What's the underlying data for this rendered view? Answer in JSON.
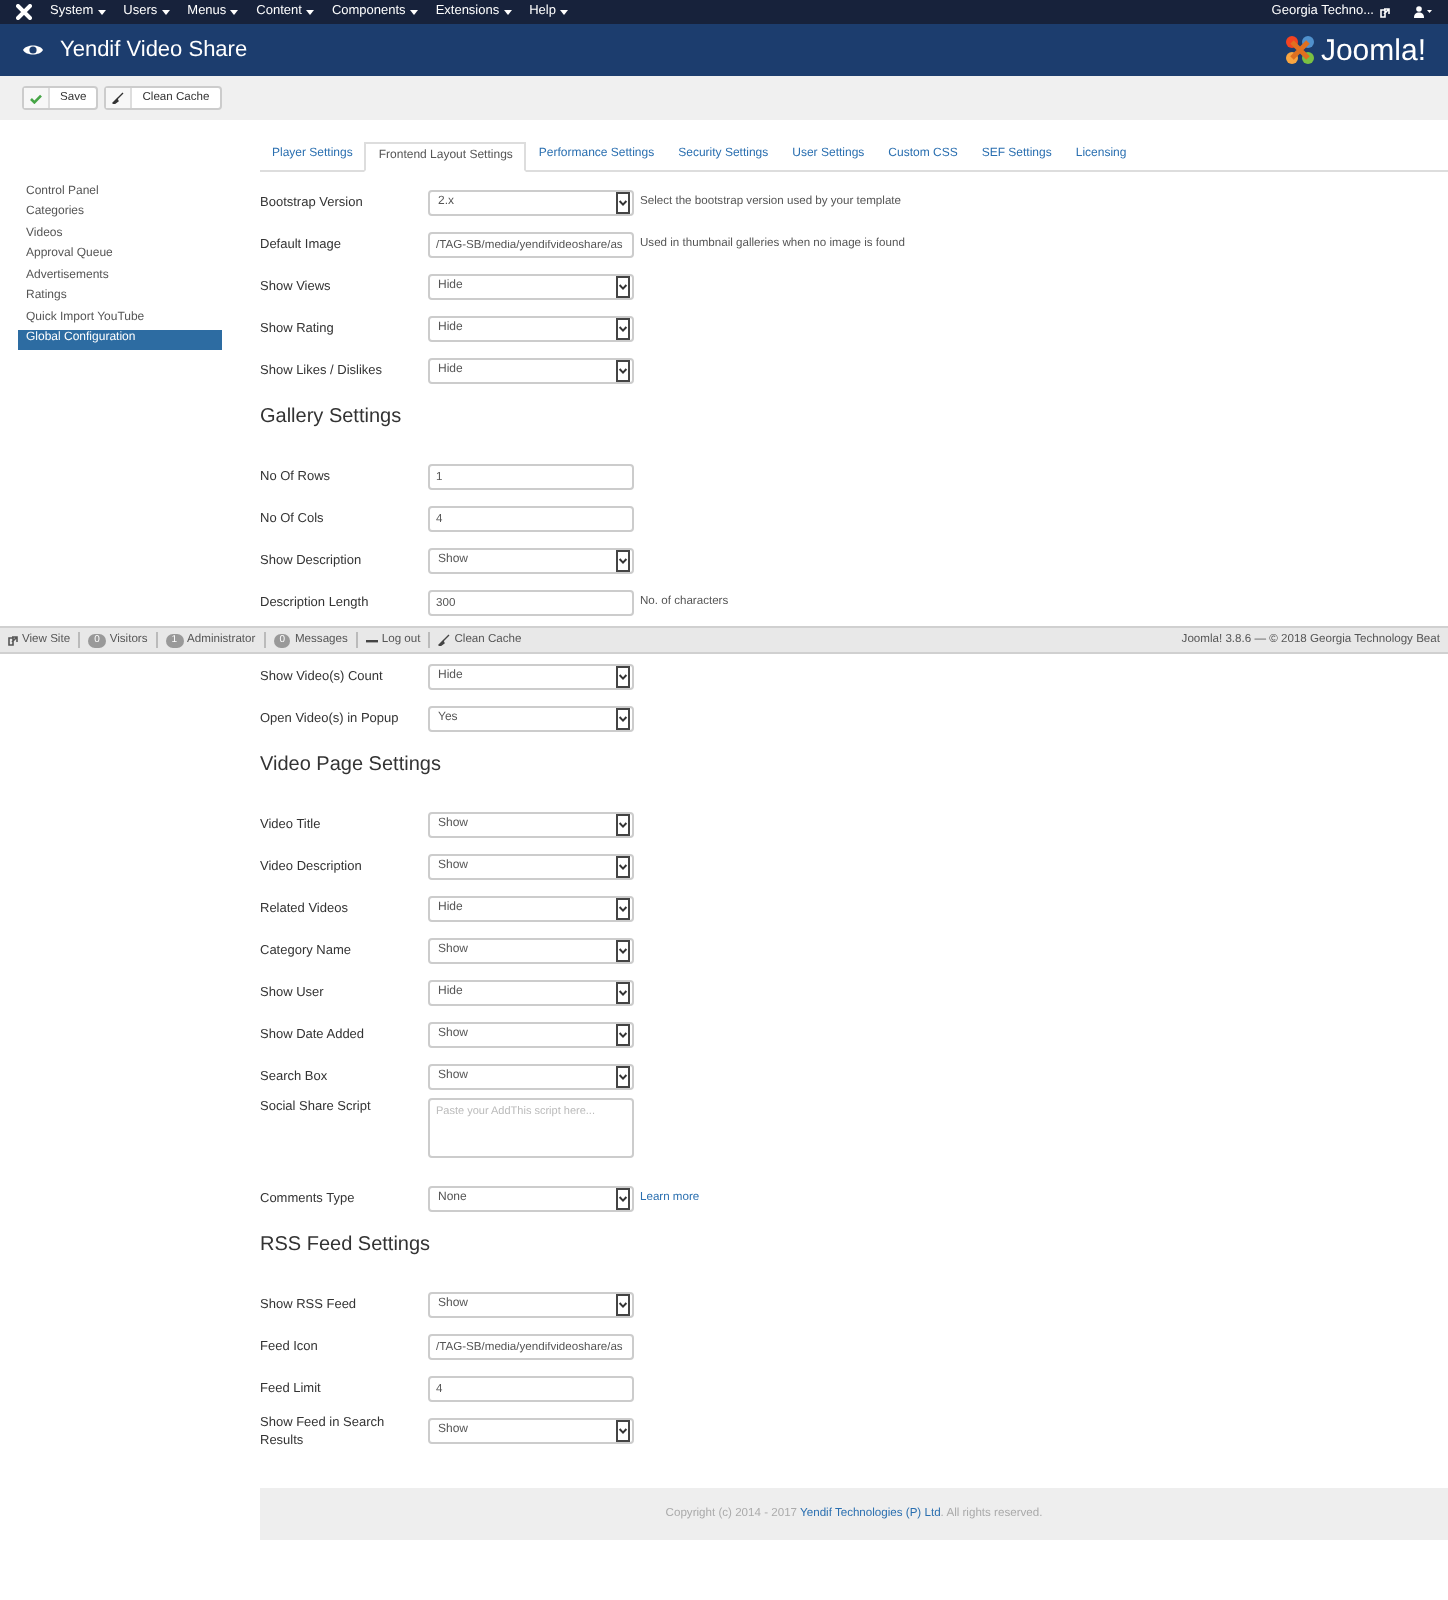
{
  "topbar": {
    "menus": [
      "System",
      "Users",
      "Menus",
      "Content",
      "Components",
      "Extensions",
      "Help"
    ],
    "site": "Georgia Techno..."
  },
  "header": {
    "title": "Yendif Video Share",
    "logo_text": "Joomla!"
  },
  "toolbar": {
    "buttons": [
      {
        "label": "Save",
        "kind": "save"
      },
      {
        "label": "Clean Cache",
        "kind": "clean"
      }
    ]
  },
  "sidebar": {
    "items": [
      {
        "label": "Control Panel",
        "selected": false
      },
      {
        "label": "Categories",
        "selected": false
      },
      {
        "label": "Videos",
        "selected": false
      },
      {
        "label": "Approval Queue",
        "selected": false
      },
      {
        "label": "Advertisements",
        "selected": false
      },
      {
        "label": "Ratings",
        "selected": false
      },
      {
        "label": "Quick Import YouTube",
        "selected": false
      },
      {
        "label": "Global Configuration",
        "selected": true
      }
    ]
  },
  "tabs": [
    {
      "label": "Player Settings",
      "selected": false
    },
    {
      "label": "Frontend Layout Settings",
      "selected": true
    },
    {
      "label": "Performance Settings",
      "selected": false
    },
    {
      "label": "Security Settings",
      "selected": false
    },
    {
      "label": "User Settings",
      "selected": false
    },
    {
      "label": "Custom CSS",
      "selected": false
    },
    {
      "label": "SEF Settings",
      "selected": false
    },
    {
      "label": "Licensing",
      "selected": false
    }
  ],
  "sections": [
    {
      "fields": [
        {
          "label": "Bootstrap Version",
          "kind": "select",
          "value": "2.x",
          "help": "Select the bootstrap version used by your template"
        },
        {
          "label": "Default Image",
          "kind": "text",
          "value": "/TAG-SB/media/yendifvideoshare/as",
          "help": "Used in thumbnail galleries when no image is found"
        },
        {
          "label": "Show Views",
          "kind": "select",
          "value": "Hide"
        },
        {
          "label": "Show Rating",
          "kind": "select",
          "value": "Hide"
        },
        {
          "label": "Show Likes / Dislikes",
          "kind": "select",
          "value": "Hide"
        }
      ]
    },
    {
      "heading": "Gallery Settings",
      "fields": [
        {
          "label": "No Of Rows",
          "kind": "text",
          "value": "1"
        },
        {
          "label": "No Of Cols",
          "kind": "text",
          "value": "4"
        },
        {
          "label": "Show Description",
          "kind": "select",
          "value": "Show"
        },
        {
          "label": "Description Length",
          "kind": "text",
          "value": "300",
          "help": "No. of characters"
        },
        {
          "kind": "statusbar"
        },
        {
          "label": "Show Video(s) Count",
          "kind": "select",
          "value": "Hide"
        },
        {
          "label": "Open Video(s) in Popup",
          "kind": "select",
          "value": "Yes"
        }
      ]
    },
    {
      "heading": "Video Page Settings",
      "fields": [
        {
          "label": "Video Title",
          "kind": "select",
          "value": "Show"
        },
        {
          "label": "Video Description",
          "kind": "select",
          "value": "Show"
        },
        {
          "label": "Related Videos",
          "kind": "select",
          "value": "Hide"
        },
        {
          "label": "Category Name",
          "kind": "select",
          "value": "Show"
        },
        {
          "label": "Show User",
          "kind": "select",
          "value": "Hide"
        },
        {
          "label": "Show Date Added",
          "kind": "select",
          "value": "Show"
        },
        {
          "label": "Search Box",
          "kind": "select",
          "value": "Show"
        },
        {
          "label": "Social Share Script",
          "kind": "textarea",
          "placeholder": "Paste your AddThis script here..."
        },
        {
          "label": "Comments Type",
          "kind": "select",
          "value": "None",
          "link": "Learn more"
        }
      ]
    },
    {
      "heading": "RSS Feed Settings",
      "fields": [
        {
          "label": "Show RSS Feed",
          "kind": "select",
          "value": "Show"
        },
        {
          "label": "Feed Icon",
          "kind": "text",
          "value": "/TAG-SB/media/yendifvideoshare/as"
        },
        {
          "label": "Feed Limit",
          "kind": "text",
          "value": "4"
        },
        {
          "label": "Show Feed in Search Results",
          "kind": "select",
          "value": "Show"
        }
      ]
    }
  ],
  "status_bar": {
    "items": [
      {
        "kind": "link",
        "label": "View Site"
      },
      {
        "kind": "count",
        "count": "0",
        "label": "Visitors"
      },
      {
        "kind": "count",
        "count": "1",
        "label": "Administrator"
      },
      {
        "kind": "count",
        "count": "0",
        "label": "Messages"
      },
      {
        "kind": "logout",
        "label": "Log out"
      },
      {
        "kind": "clean",
        "label": "Clean Cache"
      }
    ],
    "version": "Joomla! 3.8.6 — © 2018 Georgia Technology Beat"
  },
  "footer": {
    "before": "Copyright (c) 2014 - 2017",
    "link": "Yendif Technologies (P) Ltd",
    "after": ". All rights reserved."
  }
}
